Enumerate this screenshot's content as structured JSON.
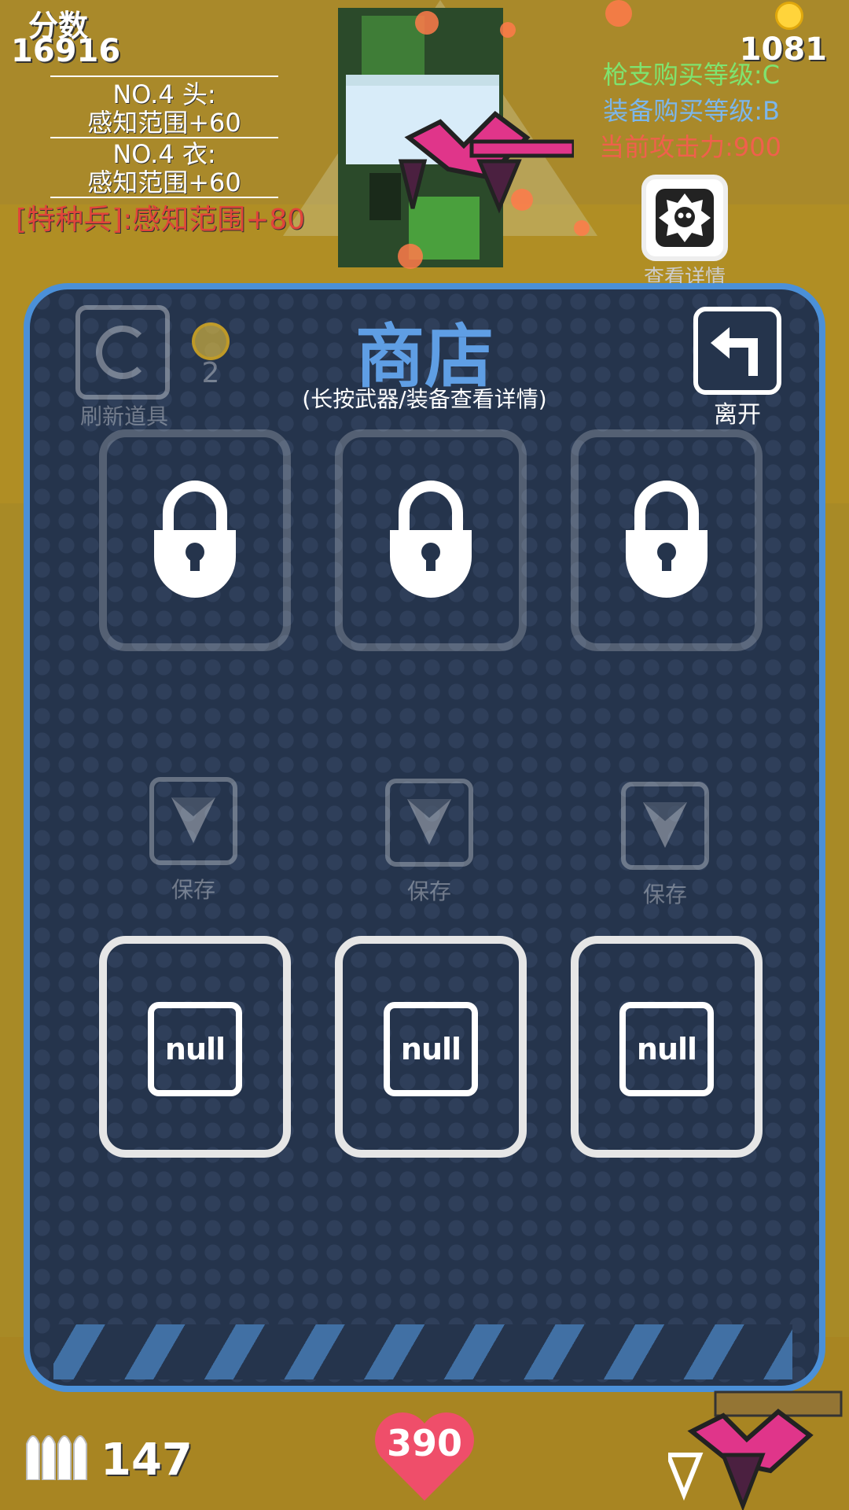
{
  "hud": {
    "score_label": "分数",
    "score_value": "16916",
    "coin_value": "1081",
    "gun_level": "枪支购买等级:C",
    "equip_level": "装备购买等级:B",
    "attack_power": "当前攻击力:900",
    "equip_head_title": "NO.4 头:",
    "equip_head_bonus": "感知范围+60",
    "equip_body_title": "NO.4 衣:",
    "equip_body_bonus": "感知范围+60",
    "special_bonus": "[特种兵]:感知范围+80",
    "detail_label": "查看详情",
    "ammo_count": "147",
    "health": "390"
  },
  "shop": {
    "title": "商店",
    "subtitle": "(长按武器/装备查看详情)",
    "refresh_label": "刷新道具",
    "refresh_cost": "2",
    "leave_label": "离开",
    "save_label": "保存",
    "null_label": "null"
  },
  "colors": {
    "panel_border": "#4b90d8",
    "panel_bg": "#25344c",
    "title": "#5f9ee4",
    "gun_level": "#7fe36f",
    "equip_level": "#7cb6ea",
    "attack": "#f0604c",
    "special": "#e0453a",
    "heart": "#ef4e6a"
  }
}
